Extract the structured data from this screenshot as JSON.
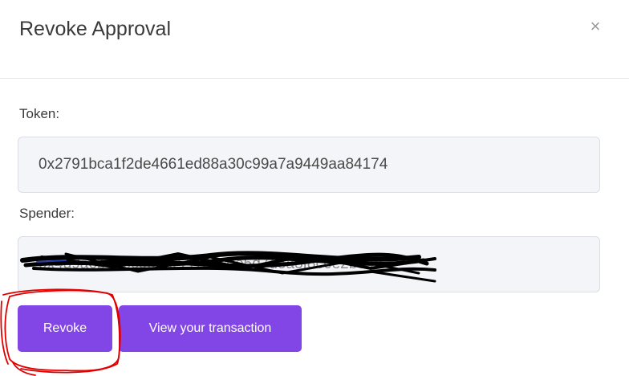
{
  "modal": {
    "title": "Revoke Approval",
    "close_glyph": "×"
  },
  "form": {
    "token_label": "Token:",
    "token_value": "0x2791bca1f2de4661ed88a30c99a7a9449aa84174",
    "spender_label": "Spender:",
    "spender_value": "0x4d9a6b0a6c0d8e22f1b3c0e5d7d5a3f8c6e2b84a"
  },
  "actions": {
    "revoke_label": "Revoke",
    "view_label": "View your transaction"
  },
  "colors": {
    "accent": "#8245e6",
    "input_bg": "#f4f5f9",
    "annotation": "#e00000"
  }
}
